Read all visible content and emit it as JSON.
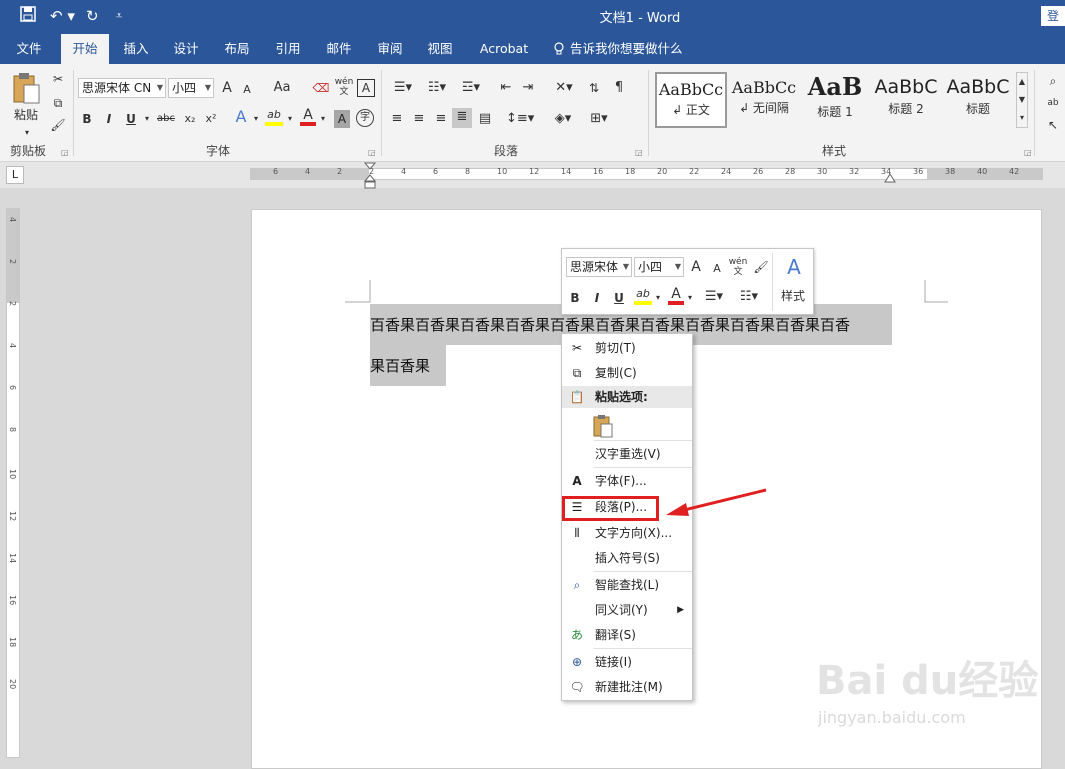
{
  "window": {
    "title": "文档1 - Word",
    "login": "登"
  },
  "quick_access": {
    "save_icon": "save-icon",
    "undo_icon": "undo-icon",
    "redo_icon": "redo-icon",
    "customize_icon": "customize-icon"
  },
  "tabs": [
    {
      "label": "文件"
    },
    {
      "label": "开始",
      "active": true
    },
    {
      "label": "插入"
    },
    {
      "label": "设计"
    },
    {
      "label": "布局"
    },
    {
      "label": "引用"
    },
    {
      "label": "邮件"
    },
    {
      "label": "审阅"
    },
    {
      "label": "视图"
    },
    {
      "label": "Acrobat"
    }
  ],
  "tell_me": "告诉我你想要做什么",
  "ribbon": {
    "clipboard": {
      "label": "剪贴板",
      "paste": "粘贴"
    },
    "font": {
      "label": "字体",
      "font_name": "思源宋体 CN",
      "font_size": "小四",
      "buttons": {
        "bold": "B",
        "italic": "I",
        "underline": "U",
        "strike": "abc",
        "sub": "x₂",
        "sup": "x²",
        "grow": "A",
        "shrink": "A",
        "change_case": "Aa",
        "phonetic": "wén",
        "char_border": "A",
        "char_shade": "A",
        "enclose": "字",
        "highlight": "ab",
        "font_color": "A",
        "effects": "A"
      }
    },
    "paragraph": {
      "label": "段落"
    },
    "styles": {
      "label": "样式",
      "items": [
        {
          "sample": "AaBbCc",
          "name": "↲ 正文"
        },
        {
          "sample": "AaBbCc",
          "name": "↲ 无间隔"
        },
        {
          "sample": "AaB",
          "name": "标题 1"
        },
        {
          "sample": "AaBbC",
          "name": "标题 2"
        },
        {
          "sample": "AaBbC",
          "name": "标题"
        }
      ]
    }
  },
  "ruler": {
    "h_labels": [
      "6",
      "4",
      "2",
      "2",
      "4",
      "6",
      "8",
      "10",
      "12",
      "14",
      "16",
      "18",
      "20",
      "22",
      "24",
      "26",
      "28",
      "30",
      "32",
      "34",
      "36",
      "38",
      "40",
      "42"
    ],
    "v_labels": [
      "4",
      "2",
      "2",
      "4",
      "6",
      "8",
      "10",
      "12",
      "14",
      "16",
      "18",
      "20"
    ],
    "corner": "L"
  },
  "document": {
    "line1": "百香果百香果百香果百香果百香果百香果百香果百香果百香果百香果百香",
    "line2": "果百香果"
  },
  "mini_toolbar": {
    "font_name": "思源宋体",
    "font_size": "小四",
    "styles_label": "样式",
    "bold": "B",
    "italic": "I",
    "underline": "U",
    "grow": "A",
    "shrink": "A",
    "phonetic": "wén",
    "highlight": "ab",
    "font_color": "A"
  },
  "context_menu": {
    "cut": "剪切(T)",
    "copy": "复制(C)",
    "paste_options": "粘贴选项:",
    "reconvert": "汉字重选(V)",
    "font": "字体(F)...",
    "paragraph": "段落(P)...",
    "text_direction": "文字方向(X)...",
    "insert_symbol": "插入符号(S)",
    "smart_lookup": "智能查找(L)",
    "synonyms": "同义词(Y)",
    "translate": "翻译(S)",
    "link": "链接(I)",
    "new_comment": "新建批注(M)"
  },
  "watermark": {
    "brand": "Bai du经验",
    "url": "jingyan.baidu.com"
  },
  "colors": {
    "ribbon_blue": "#2b579a",
    "highlight_red": "#e02020",
    "selection_gray": "#c8c8c8"
  }
}
